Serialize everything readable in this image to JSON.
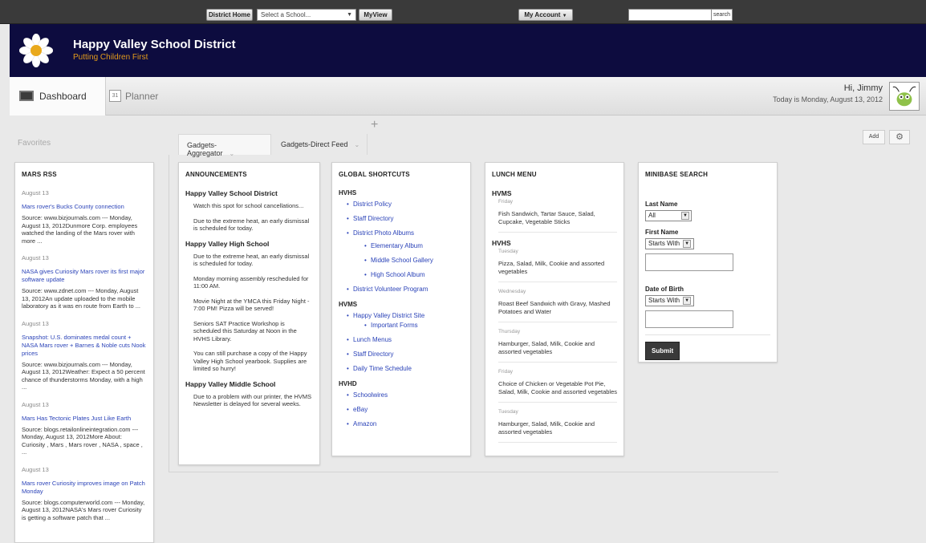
{
  "topbar": {
    "district_home": "District Home",
    "school_select": "Select a School...",
    "myview": "MyView",
    "my_account": "My Account",
    "search_button": "search"
  },
  "banner": {
    "title": "Happy Valley School District",
    "tagline": "Putting Children First"
  },
  "nav": {
    "dashboard": "Dashboard",
    "planner": "Planner",
    "planner_icon_text": "31",
    "greeting": "Hi, Jimmy",
    "date": "Today is Monday, August 13, 2012"
  },
  "toolbar": {
    "favorites": "Favorites",
    "tab1": "Gadgets-Aggregator",
    "tab2": "Gadgets-Direct Feed",
    "add": "Add"
  },
  "mars": {
    "title": "MARS RSS",
    "items": [
      {
        "date": "August 13",
        "title": "Mars rover's Bucks County connection",
        "body": "Source: www.bizjournals.com --- Monday, August 13, 2012Dunmore Corp. employees watched the landing of the Mars rover with more ..."
      },
      {
        "date": "August 13",
        "title": "NASA gives Curiosity Mars rover its first major software update",
        "body": "Source: www.zdnet.com --- Monday, August 13, 2012An update uploaded to the mobile laboratory as it was en route from Earth to ..."
      },
      {
        "date": "August 13",
        "title": "Snapshot: U.S. dominates medal count + NASA Mars rover + Barnes & Noble cuts Nook prices",
        "body": "Source: www.bizjournals.com --- Monday, August 13, 2012Weather: Expect a 50 percent chance of thunderstorms Monday, with a high ..."
      },
      {
        "date": "August 13",
        "title": "Mars Has Tectonic Plates Just Like Earth",
        "body": "Source: blogs.retailonlineintegration.com --- Monday, August 13, 2012More About: Curiosity , Mars , Mars rover , NASA , space , ..."
      },
      {
        "date": "August 13",
        "title": "Mars rover Curiosity improves image on Patch Monday",
        "body": "Source: blogs.computerworld.com --- Monday, August 13, 2012NASA's Mars rover Curiosity is getting a software patch that ..."
      }
    ]
  },
  "announcements": {
    "title": "ANNOUNCEMENTS",
    "schools": [
      {
        "name": "Happy Valley School District",
        "messages": [
          "Watch this spot for school cancellations...",
          "Due to the extreme heat, an early dismissal is scheduled for today."
        ]
      },
      {
        "name": "Happy Valley High School",
        "messages": [
          "Due to the extreme heat, an early dismissal is scheduled for today.",
          "Monday morning assembly rescheduled for 11:00 AM.",
          "Movie Night at the YMCA this Friday Night - 7:00 PM! Pizza will be served!",
          "Seniors SAT Practice Workshop is scheduled this Saturday at Noon in the HVHS Library.",
          "You can still purchase a copy of the Happy Valley High School yearbook. Supplies are limited so hurry!"
        ]
      },
      {
        "name": "Happy Valley Middle School",
        "messages": [
          "Due to a problem with our printer, the HVMS Newsletter is delayed for several weeks."
        ]
      }
    ]
  },
  "shortcuts": {
    "title": "GLOBAL SHORTCUTS",
    "hvhs": "HVHS",
    "hvhs_items": [
      "District Policy",
      "Staff Directory",
      "District Photo Albums"
    ],
    "albums": [
      "Elementary Album",
      "Middle School Gallery",
      "High School Album"
    ],
    "volunteer": "District Volunteer Program",
    "hvms": "HVMS",
    "hvms_site": "Happy Valley District Site",
    "important_forms": "Important Forms",
    "hvms_items": [
      "Lunch Menus",
      "Staff Directory",
      "Daily Time Schedule"
    ],
    "hvhd": "HVHD",
    "hvhd_items": [
      "Schoolwires",
      "eBay",
      "Amazon"
    ]
  },
  "lunch": {
    "title": "LUNCH MENU",
    "hvms": "HVMS",
    "hvms_day": "Friday",
    "hvms_menu": "Fish Sandwich, Tartar Sauce, Salad, Cupcake, Vegetable Sticks",
    "hvhs": "HVHS",
    "hvhs_days": [
      {
        "day": "Tuesday",
        "menu": "Pizza, Salad, Milk, Cookie and assorted vegetables"
      },
      {
        "day": "Wednesday",
        "menu": "Roast Beef Sandwich with Gravy, Mashed Potatoes and Water"
      },
      {
        "day": "Thursday",
        "menu": "Hamburger, Salad, Milk, Cookie and assorted vegetables"
      },
      {
        "day": "Friday",
        "menu": "Choice of Chicken or Vegetable Pot Pie, Salad, Milk, Cookie and assorted vegetables"
      },
      {
        "day": "Tuesday",
        "menu": "Hamburger, Salad, Milk, Cookie and assorted vegetables"
      }
    ]
  },
  "minibase": {
    "title": "MINIBASE SEARCH",
    "last_name": "Last Name",
    "last_name_value": "All",
    "first_name": "First Name",
    "first_name_mode": "Starts With",
    "dob": "Date of Birth",
    "dob_mode": "Starts With",
    "submit": "Submit"
  },
  "colors": {
    "banner": "#0d0c3f",
    "tagline": "#e39b1b",
    "link": "#2b43b8"
  }
}
